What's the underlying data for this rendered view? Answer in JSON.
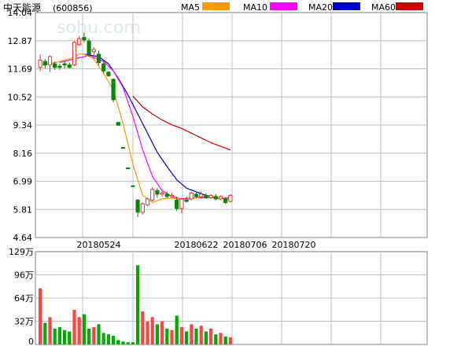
{
  "chart_data": {
    "type": "candlestick",
    "title": "中天能源",
    "code": "(600856)",
    "watermark": "sohu.com",
    "price_axis": {
      "ticks": [
        "14.04",
        "12.87",
        "11.69",
        "10.52",
        "9.34",
        "8.16",
        "6.99",
        "5.81",
        "4.64"
      ],
      "ylim": [
        4.64,
        14.04
      ]
    },
    "volume_axis": {
      "ticks": [
        "129万",
        "96万",
        "64万",
        "32万",
        "0"
      ],
      "ylim": [
        0,
        129
      ]
    },
    "date_labels": [
      {
        "label": "20180524",
        "index": 12
      },
      {
        "label": "20180622",
        "index": 32
      },
      {
        "label": "20180706",
        "index": 42
      },
      {
        "label": "20180720",
        "index": 52
      }
    ],
    "legend": [
      {
        "name": "MA5",
        "color": "#ff9900"
      },
      {
        "name": "MA10",
        "color": "#ff00ff"
      },
      {
        "name": "MA20",
        "color": "#0000cc"
      },
      {
        "name": "MA60",
        "color": "#cc0000"
      }
    ],
    "colors": {
      "up": "#e53333",
      "down": "#008800",
      "vol_up": "#ff4444",
      "vol_down": "#00aa00",
      "grid": "#c0c0c0"
    },
    "candles": [
      {
        "o": 11.75,
        "h": 12.3,
        "l": 11.6,
        "c": 12.05
      },
      {
        "o": 12.0,
        "h": 12.1,
        "l": 11.7,
        "c": 11.85
      },
      {
        "o": 11.85,
        "h": 12.25,
        "l": 11.55,
        "c": 12.2
      },
      {
        "o": 11.9,
        "h": 12.0,
        "l": 11.65,
        "c": 11.75
      },
      {
        "o": 11.8,
        "h": 11.9,
        "l": 11.65,
        "c": 11.75
      },
      {
        "o": 11.9,
        "h": 12.0,
        "l": 11.7,
        "c": 11.85
      },
      {
        "o": 11.85,
        "h": 11.95,
        "l": 11.7,
        "c": 11.75
      },
      {
        "o": 11.85,
        "h": 12.85,
        "l": 11.8,
        "c": 12.8
      },
      {
        "o": 12.7,
        "h": 13.05,
        "l": 12.65,
        "c": 12.95
      },
      {
        "o": 13.0,
        "h": 13.2,
        "l": 12.8,
        "c": 12.9
      },
      {
        "o": 12.85,
        "h": 12.95,
        "l": 12.2,
        "c": 12.3
      },
      {
        "o": 12.4,
        "h": 12.6,
        "l": 12.1,
        "c": 12.5
      },
      {
        "o": 12.3,
        "h": 12.45,
        "l": 11.85,
        "c": 11.95
      },
      {
        "o": 11.9,
        "h": 12.05,
        "l": 11.5,
        "c": 11.6
      },
      {
        "o": 11.55,
        "h": 11.6,
        "l": 11.35,
        "c": 11.4
      },
      {
        "o": 11.25,
        "h": 11.3,
        "l": 10.3,
        "c": 10.4
      },
      {
        "o": 9.45,
        "h": 9.45,
        "l": 9.32,
        "c": 9.33
      },
      {
        "o": 8.4,
        "h": 8.4,
        "l": 8.39,
        "c": 8.39
      },
      {
        "o": 7.55,
        "h": 7.55,
        "l": 7.54,
        "c": 7.54
      },
      {
        "o": 6.8,
        "h": 6.8,
        "l": 6.79,
        "c": 6.79
      },
      {
        "o": 6.2,
        "h": 6.25,
        "l": 5.5,
        "c": 5.7
      },
      {
        "o": 5.7,
        "h": 6.1,
        "l": 5.6,
        "c": 6.05
      },
      {
        "o": 6.0,
        "h": 6.3,
        "l": 5.95,
        "c": 6.25
      },
      {
        "o": 6.2,
        "h": 6.75,
        "l": 6.15,
        "c": 6.65
      },
      {
        "o": 6.6,
        "h": 6.7,
        "l": 6.3,
        "c": 6.45
      },
      {
        "o": 6.45,
        "h": 6.65,
        "l": 6.35,
        "c": 6.5
      },
      {
        "o": 6.45,
        "h": 6.55,
        "l": 6.3,
        "c": 6.35
      },
      {
        "o": 6.35,
        "h": 6.5,
        "l": 6.3,
        "c": 6.4
      },
      {
        "o": 6.2,
        "h": 6.35,
        "l": 5.75,
        "c": 5.85
      },
      {
        "o": 5.85,
        "h": 6.3,
        "l": 5.65,
        "c": 6.25
      },
      {
        "o": 6.2,
        "h": 6.35,
        "l": 6.1,
        "c": 6.15
      },
      {
        "o": 6.25,
        "h": 6.55,
        "l": 6.2,
        "c": 6.5
      },
      {
        "o": 6.45,
        "h": 6.55,
        "l": 6.3,
        "c": 6.35
      },
      {
        "o": 6.35,
        "h": 6.55,
        "l": 6.3,
        "c": 6.45
      },
      {
        "o": 6.4,
        "h": 6.5,
        "l": 6.25,
        "c": 6.3
      },
      {
        "o": 6.3,
        "h": 6.45,
        "l": 6.25,
        "c": 6.4
      },
      {
        "o": 6.35,
        "h": 6.45,
        "l": 6.2,
        "c": 6.25
      },
      {
        "o": 6.25,
        "h": 6.4,
        "l": 6.2,
        "c": 6.35
      },
      {
        "o": 6.25,
        "h": 6.3,
        "l": 6.05,
        "c": 6.1
      },
      {
        "o": 6.15,
        "h": 6.45,
        "l": 6.1,
        "c": 6.4
      }
    ],
    "volume": [
      78,
      30,
      38,
      22,
      24,
      20,
      18,
      48,
      38,
      42,
      22,
      24,
      28,
      16,
      14,
      12,
      6,
      4,
      3,
      3,
      110,
      46,
      32,
      38,
      28,
      32,
      22,
      20,
      40,
      24,
      18,
      28,
      22,
      26,
      18,
      22,
      14,
      16,
      11,
      10
    ],
    "ma5": [
      [
        0,
        11.85
      ],
      [
        3,
        11.95
      ],
      [
        6,
        12.1
      ],
      [
        8,
        12.3
      ],
      [
        9,
        12.3
      ],
      [
        11,
        12.1
      ],
      [
        13,
        11.5
      ],
      [
        15,
        10.8
      ],
      [
        17,
        9.4
      ],
      [
        19,
        7.7
      ],
      [
        21,
        6.4
      ],
      [
        23,
        6.1
      ],
      [
        25,
        6.25
      ],
      [
        27,
        6.3
      ],
      [
        29,
        6.2
      ],
      [
        31,
        6.25
      ],
      [
        33,
        6.35
      ],
      [
        35,
        6.3
      ],
      [
        37,
        6.3
      ],
      [
        39,
        6.25
      ]
    ],
    "ma10": [
      [
        4,
        11.95
      ],
      [
        7,
        12.1
      ],
      [
        10,
        12.25
      ],
      [
        13,
        12.0
      ],
      [
        15,
        11.6
      ],
      [
        17,
        10.9
      ],
      [
        19,
        9.7
      ],
      [
        21,
        8.3
      ],
      [
        23,
        7.2
      ],
      [
        25,
        6.6
      ],
      [
        27,
        6.35
      ],
      [
        29,
        6.25
      ],
      [
        31,
        6.3
      ],
      [
        33,
        6.3
      ],
      [
        35,
        6.3
      ],
      [
        37,
        6.3
      ],
      [
        39,
        6.3
      ]
    ],
    "ma20": [
      [
        9,
        12.3
      ],
      [
        12,
        12.2
      ],
      [
        14,
        11.9
      ],
      [
        16,
        11.3
      ],
      [
        18,
        10.6
      ],
      [
        20,
        9.8
      ],
      [
        22,
        9.0
      ],
      [
        24,
        8.2
      ],
      [
        26,
        7.6
      ],
      [
        28,
        7.05
      ],
      [
        30,
        6.7
      ],
      [
        32,
        6.55
      ],
      [
        34,
        6.4
      ],
      [
        36,
        6.3
      ],
      [
        38,
        6.25
      ],
      [
        39,
        6.25
      ]
    ],
    "ma60": [
      [
        19,
        10.55
      ],
      [
        21,
        10.1
      ],
      [
        23,
        9.8
      ],
      [
        25,
        9.55
      ],
      [
        27,
        9.35
      ],
      [
        29,
        9.2
      ],
      [
        31,
        9.0
      ],
      [
        33,
        8.8
      ],
      [
        35,
        8.6
      ],
      [
        37,
        8.45
      ],
      [
        39,
        8.3
      ]
    ]
  }
}
